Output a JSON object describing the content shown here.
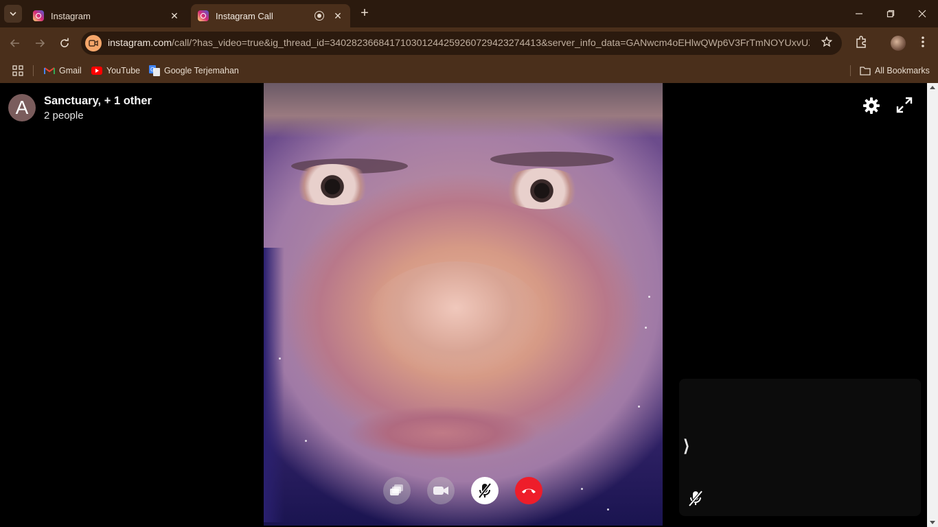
{
  "browser": {
    "tabs": [
      {
        "title": "Instagram",
        "active": false
      },
      {
        "title": "Instagram Call",
        "active": true
      }
    ],
    "url_main": "instagram.com",
    "url_rest": "/call/?has_video=true&ig_thread_id=340282366841710301244259260729423274413&server_info_data=GANwcm4oEHlwQWp6V3FrTmNOYUxvUXkW...",
    "bookmarks": [
      {
        "label": "Gmail",
        "icon": "gmail-icon"
      },
      {
        "label": "YouTube",
        "icon": "youtube-icon"
      },
      {
        "label": "Google Terjemahan",
        "icon": "translate-icon"
      }
    ],
    "all_bookmarks": "All Bookmarks"
  },
  "call": {
    "avatar_letter": "A",
    "title": "Sanctuary, + 1 other",
    "subtitle": "2 people",
    "controls": [
      {
        "name": "share-screen-button",
        "icon": "screen-share-icon"
      },
      {
        "name": "video-toggle-button",
        "icon": "video-camera-icon"
      },
      {
        "name": "mute-button",
        "icon": "mic-off-icon",
        "state": "muted"
      },
      {
        "name": "end-call-button",
        "icon": "phone-hangup-icon"
      }
    ],
    "pip_chevron": "⟩"
  },
  "colors": {
    "chrome_dark": "#2b1a0e",
    "chrome_mid": "#4a2f1b",
    "end_call_red": "#ee1d2a"
  }
}
